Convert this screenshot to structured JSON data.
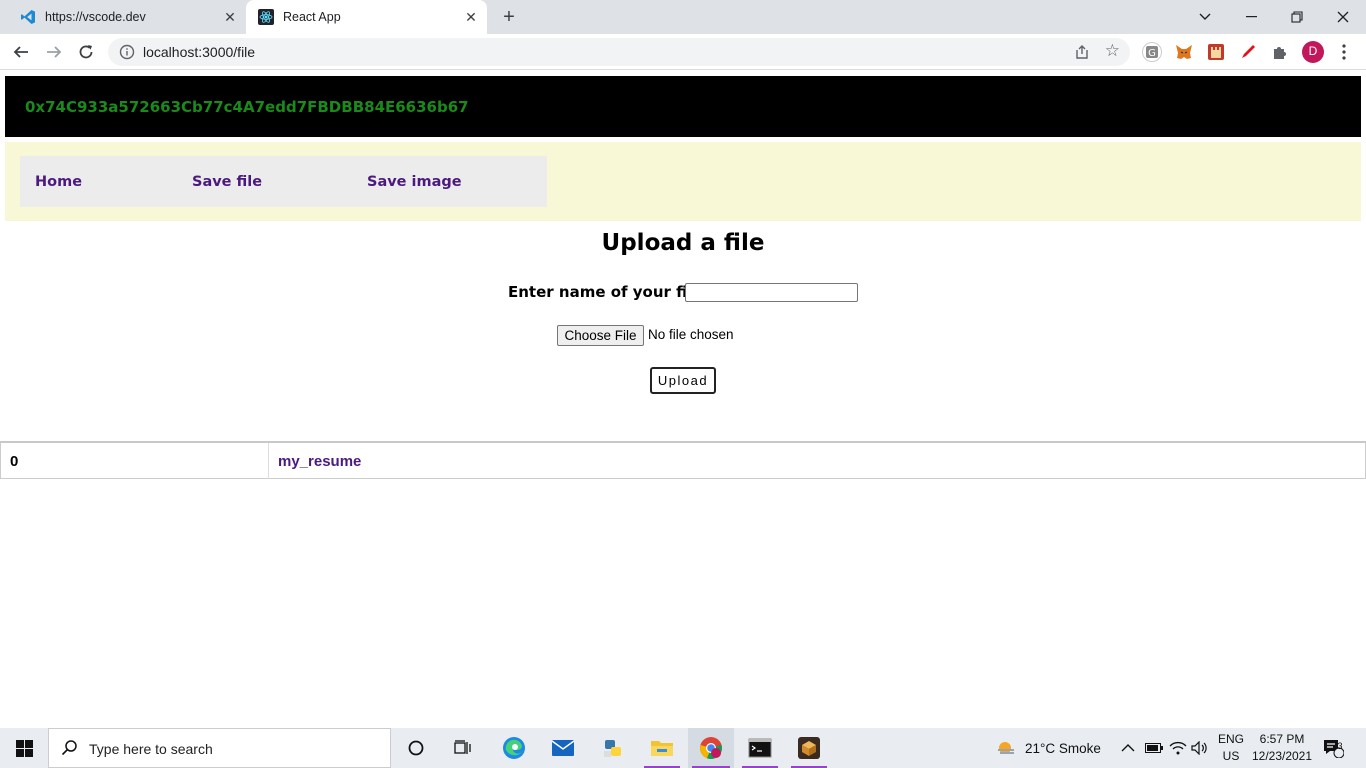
{
  "browser": {
    "tabs": [
      {
        "title": "https://vscode.dev",
        "active": false
      },
      {
        "title": "React App",
        "active": true
      }
    ],
    "address_url": "localhost:3000/file",
    "profile_initial": "D"
  },
  "app": {
    "account_address": "0x74C933a572663Cb77c4A7edd7FBDBB84E6636b67",
    "nav": [
      {
        "label": "Home"
      },
      {
        "label": "Save file"
      },
      {
        "label": "Save image"
      }
    ],
    "heading": "Upload a file",
    "file_name_label": "Enter name of your file",
    "file_name_value": "",
    "choose_file_label": "Choose File",
    "no_file_text": "No file chosen",
    "upload_label": "Upload",
    "files_table": {
      "rows": [
        {
          "id": "0",
          "name": "my_resume"
        }
      ]
    }
  },
  "taskbar": {
    "search_placeholder": "Type here to search",
    "weather": "21°C  Smoke",
    "lang_line1": "ENG",
    "lang_line2": "US",
    "time": "6:57 PM",
    "date": "12/23/2021",
    "notification_count": "3"
  },
  "colors": {
    "account_text": "#1a8a1a",
    "nav_link": "#4b1a80",
    "nav_panel_bg": "#f8f8d6"
  }
}
